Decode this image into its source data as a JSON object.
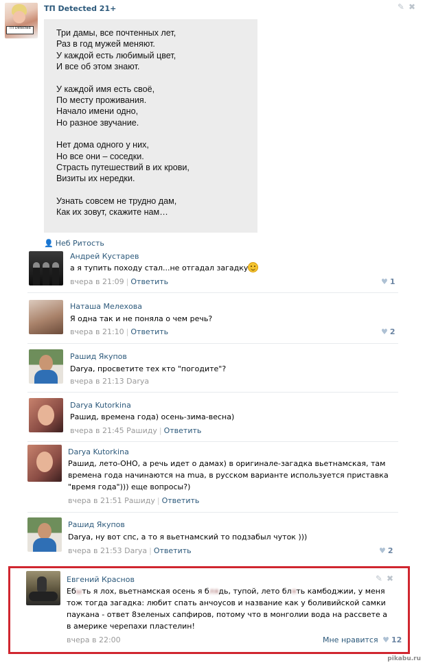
{
  "post": {
    "author": "ТП Detected 21+",
    "avatar_badge": "ТП Detected",
    "poem": [
      [
        "Три дамы, все почтенных лет,",
        "Раз в год мужей меняют.",
        "У каждой есть любимый цвет,",
        "И все об этом знают."
      ],
      [
        "У каждой имя есть своё,",
        "По месту проживания.",
        "Начало имени одно,",
        "Но разное звучание."
      ],
      [
        "Нет дома одного у них,",
        "Но все они – соседки.",
        "Страсть путешествий в их крови,",
        "Визиты их нередки."
      ],
      [
        "Узнать совсем не трудно дам,",
        "Как их зовут, скажите нам…"
      ]
    ],
    "likers": "Неб Ритость"
  },
  "comments": [
    {
      "name": "Андрей Кустарев",
      "text": "а я тупить походу стал...не отгадал загадку",
      "time": "вчера в 21:09",
      "reply_to": "",
      "reply_label": "Ответить",
      "likes": "1"
    },
    {
      "name": "Наташа Мелехова",
      "text": "Я одна так и не поняла о чем речь?",
      "time": "вчера в 21:10",
      "reply_to": "",
      "reply_label": "Ответить",
      "likes": "2"
    },
    {
      "name": "Рашид Якупов",
      "text": "Darya, просветите тех кто \"погодите\"?",
      "time": "вчера в 21:13",
      "reply_to": "Darya",
      "reply_label": "",
      "likes": ""
    },
    {
      "name": "Darya Kutorkina",
      "text": "Рашид, времена года) осень-зима-весна)",
      "time": "вчера в 21:45",
      "reply_to": "Рашиду",
      "reply_label": "Ответить",
      "likes": ""
    },
    {
      "name": "Darya Kutorkina",
      "text": "Рашид, лето-ОНО, а речь идет о дамах) в оригинале-загадка вьетнамская, там времена года начинаются на mua, в русском варианте используется приставка \"время года\"))) еще вопросы?)",
      "time": "вчера в 21:51",
      "reply_to": "Рашиду",
      "reply_label": "Ответить",
      "likes": ""
    },
    {
      "name": "Рашид Якупов",
      "text": "Darya, ну вот спс, а то я вьетнамский то подзабыл чуток )))",
      "time": "вчера в 21:53",
      "reply_to": "Darya",
      "reply_label": "Ответить",
      "likes": "2"
    },
    {
      "name": "Евгений Краснов",
      "text_parts": [
        "Еб",
        "ть я лох, вьетнамская осень я б",
        "дь, тупой, лето бл",
        "ть камбоджии, у меня тож тогда загадка: любит спать анчоусов и название как у боливийской самки паукана - ответ 8зеленых сапфиров, потому что в монголии вода на рассвете а в америке черепахи пластелин!"
      ],
      "time": "вчера в 22:00",
      "like_label": "Мне нравится",
      "likes": "12"
    }
  ],
  "watermark": "pikabu.ru"
}
